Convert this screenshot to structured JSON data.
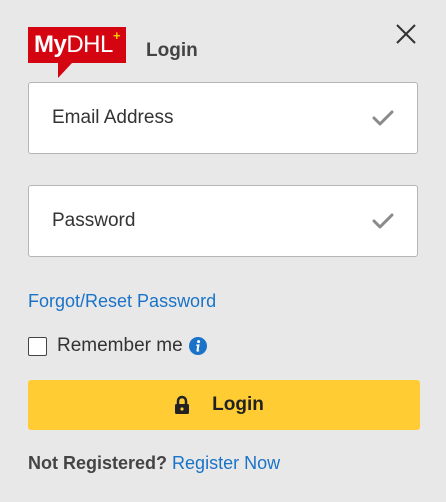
{
  "header": {
    "logo_text_my": "My",
    "logo_text_dhl": "DHL",
    "logo_plus": "+",
    "title": "Login"
  },
  "form": {
    "email_placeholder": "Email Address",
    "password_placeholder": "Password",
    "forgot_link": "Forgot/Reset Password",
    "remember_label": "Remember me",
    "remember_checked": false,
    "login_button": "Login"
  },
  "footer": {
    "not_registered": "Not Registered?",
    "register_link": "Register Now"
  },
  "icons": {
    "close": "close-icon",
    "check": "check-icon",
    "info": "info-icon",
    "lock": "lock-icon"
  },
  "colors": {
    "brand_red": "#d40511",
    "brand_yellow": "#ffcc00",
    "button_yellow": "#ffcc33",
    "link_blue": "#1a73c8",
    "background": "#e8e8e8"
  }
}
